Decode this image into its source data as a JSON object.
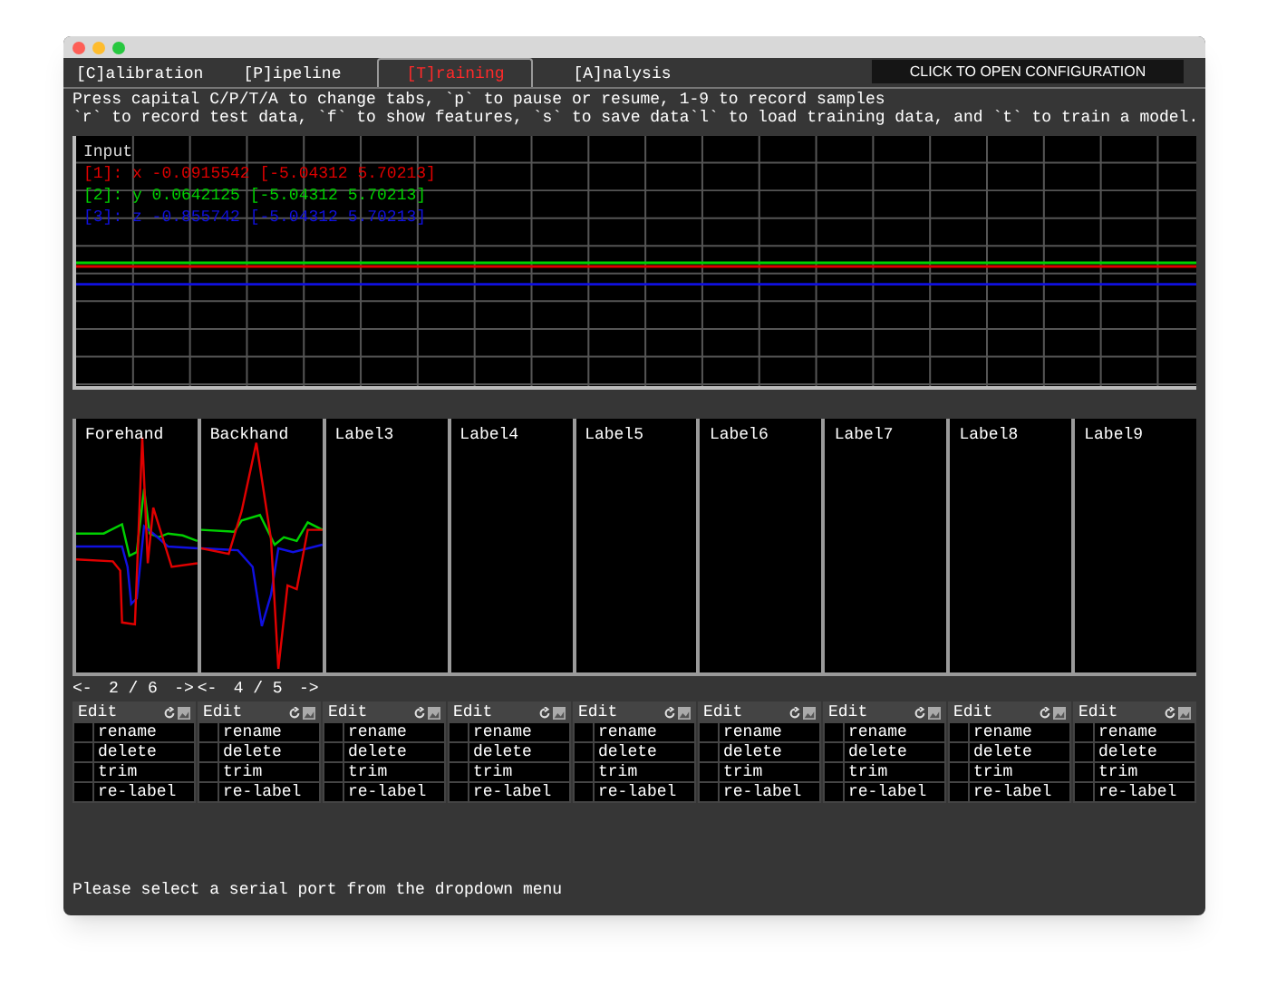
{
  "tabs": [
    {
      "label": "[C]alibration",
      "selected": false
    },
    {
      "label": "[P]ipeline",
      "selected": false
    },
    {
      "label": "[T]raining",
      "selected": true
    },
    {
      "label": "[A]nalysis",
      "selected": false
    }
  ],
  "config_button": "CLICK TO OPEN CONFIGURATION",
  "instructions": [
    "Press capital C/P/T/A to change tabs, `p` to pause or resume, 1-9 to record samples",
    "`r` to record test data, `f` to show features, `s` to save data`l` to load training data, and `t` to train a model."
  ],
  "input_plot": {
    "title": "Input",
    "legend": [
      {
        "text": "[1]: x -0.0915542 [-5.04312 5.70213]",
        "color": "#e00000"
      },
      {
        "text": "[2]: y 0.0642125 [-5.04312 5.70213]",
        "color": "#00d000"
      },
      {
        "text": "[3]: z -0.855742 [-5.04312 5.70213]",
        "color": "#1010e0"
      }
    ]
  },
  "classes": [
    {
      "label": "Forehand",
      "kind": "recorded",
      "nav": {
        "prev": "<-",
        "count": "2 / 6",
        "next": "->"
      }
    },
    {
      "label": "Backhand",
      "kind": "recorded",
      "nav": {
        "prev": "<-",
        "count": "4 / 5",
        "next": "->"
      }
    },
    {
      "label": "Label3",
      "kind": "empty"
    },
    {
      "label": "Label4",
      "kind": "empty"
    },
    {
      "label": "Label5",
      "kind": "empty"
    },
    {
      "label": "Label6",
      "kind": "empty"
    },
    {
      "label": "Label7",
      "kind": "empty"
    },
    {
      "label": "Label8",
      "kind": "empty"
    },
    {
      "label": "Label9",
      "kind": "empty"
    }
  ],
  "edit_panels": [
    {
      "title": "Edit",
      "options": [
        {
          "label": "rename",
          "checked": false
        },
        {
          "label": "delete",
          "checked": false
        },
        {
          "label": "trim",
          "checked": false
        },
        {
          "label": "re-label",
          "checked": false
        }
      ]
    },
    {
      "title": "Edit",
      "options": [
        {
          "label": "rename",
          "checked": false
        },
        {
          "label": "delete",
          "checked": false
        },
        {
          "label": "trim",
          "checked": false
        },
        {
          "label": "re-label",
          "checked": false
        }
      ]
    },
    {
      "title": "Edit",
      "options": [
        {
          "label": "rename",
          "checked": false
        },
        {
          "label": "delete",
          "checked": false
        },
        {
          "label": "trim",
          "checked": false
        },
        {
          "label": "re-label",
          "checked": false
        }
      ]
    },
    {
      "title": "Edit",
      "options": [
        {
          "label": "rename",
          "checked": false
        },
        {
          "label": "delete",
          "checked": false
        },
        {
          "label": "trim",
          "checked": false
        },
        {
          "label": "re-label",
          "checked": false
        }
      ]
    },
    {
      "title": "Edit",
      "options": [
        {
          "label": "rename",
          "checked": false
        },
        {
          "label": "delete",
          "checked": false
        },
        {
          "label": "trim",
          "checked": false
        },
        {
          "label": "re-label",
          "checked": false
        }
      ]
    },
    {
      "title": "Edit",
      "options": [
        {
          "label": "rename",
          "checked": false
        },
        {
          "label": "delete",
          "checked": false
        },
        {
          "label": "trim",
          "checked": false
        },
        {
          "label": "re-label",
          "checked": false
        }
      ]
    },
    {
      "title": "Edit",
      "options": [
        {
          "label": "rename",
          "checked": false
        },
        {
          "label": "delete",
          "checked": false
        },
        {
          "label": "trim",
          "checked": false
        },
        {
          "label": "re-label",
          "checked": false
        }
      ]
    },
    {
      "title": "Edit",
      "options": [
        {
          "label": "rename",
          "checked": false
        },
        {
          "label": "delete",
          "checked": false
        },
        {
          "label": "trim",
          "checked": false
        },
        {
          "label": "re-label",
          "checked": false
        }
      ]
    },
    {
      "title": "Edit",
      "options": [
        {
          "label": "rename",
          "checked": false
        },
        {
          "label": "delete",
          "checked": false
        },
        {
          "label": "trim",
          "checked": false
        },
        {
          "label": "re-label",
          "checked": false
        }
      ]
    }
  ],
  "status": "Please select a serial port from the dropdown menu"
}
